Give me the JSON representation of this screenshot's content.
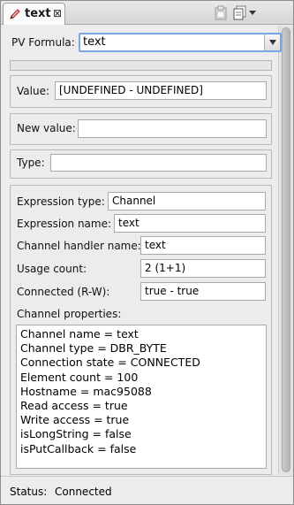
{
  "tab": {
    "title": "text",
    "close_glyph": "⊠"
  },
  "toolbar": {
    "icons": [
      "clipboard-icon",
      "copy-icon",
      "view-menu-icon"
    ]
  },
  "pv_formula": {
    "label": "PV Formula:",
    "value": "text"
  },
  "value": {
    "label": "Value:",
    "value": "[UNDEFINED - UNDEFINED]"
  },
  "new_value": {
    "label": "New value:",
    "value": ""
  },
  "type": {
    "label": "Type:",
    "value": ""
  },
  "details": {
    "expression_type": {
      "label": "Expression type:",
      "value": "Channel"
    },
    "expression_name": {
      "label": "Expression name:",
      "value": "text"
    },
    "channel_handler_name": {
      "label": "Channel handler name:",
      "value": "text"
    },
    "usage_count": {
      "label": "Usage count:",
      "value": "2 (1+1)"
    },
    "connected": {
      "label": "Connected (R-W):",
      "value": "true - true"
    },
    "channel_properties": {
      "label": "Channel properties:",
      "lines": [
        "Channel name = text",
        "Channel type = DBR_BYTE",
        "Connection state = CONNECTED",
        "Element count = 100",
        "Hostname = mac95088",
        "Read access = true",
        "Write access = true",
        "isLongString = false",
        "isPutCallback = false"
      ]
    }
  },
  "status": {
    "label": "Status:",
    "value": "Connected"
  }
}
